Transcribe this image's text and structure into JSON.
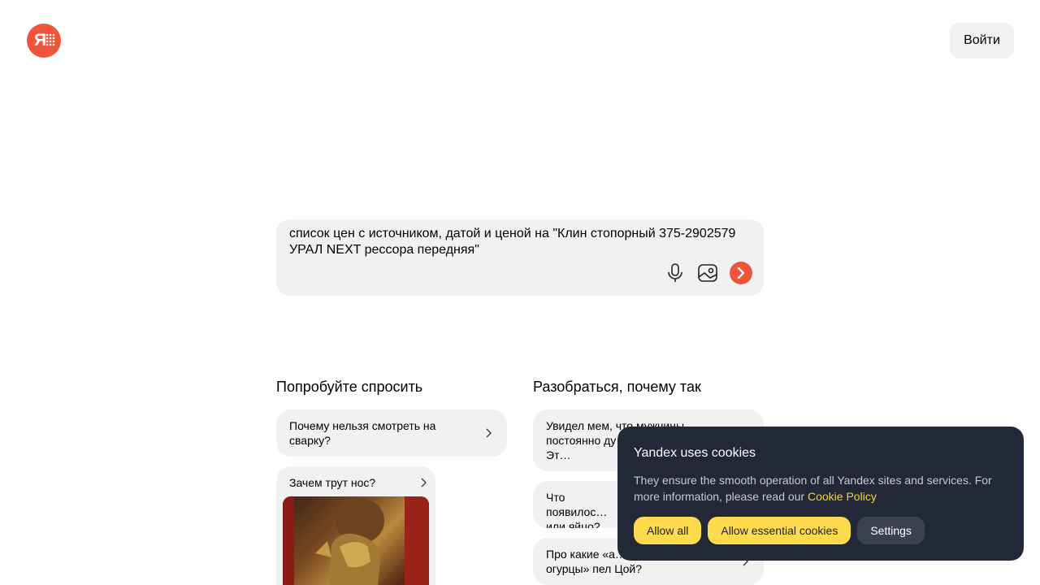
{
  "header": {
    "logo_text": "Я",
    "login_label": "Войти"
  },
  "search": {
    "value": "список цен с источником, датой и ценой на \"Клин стопорный 375-2902579 УРАЛ NEXT рессора передняя\""
  },
  "try_asking": {
    "title": "Попробуйте спросить",
    "items": [
      {
        "label": "Почему нельзя смотреть на сварку?"
      },
      {
        "label": "Зачем трут нос?"
      }
    ]
  },
  "understand_why": {
    "title": "Разобраться, почему так",
    "items": [
      {
        "label": "Увидел мем, что мужчины постоянно ду… империю. Эт…"
      },
      {
        "label": "Что появилос… или яйцо?"
      },
      {
        "label": "Про какие «а… огурцы» пел Цой?"
      }
    ]
  },
  "cookie_banner": {
    "title": "Yandex uses cookies",
    "text": "They ensure the smooth operation of all Yandex sites and services. For more information, please read our ",
    "link": "Cookie Policy",
    "allow_all": "Allow all",
    "allow_essential": "Allow essential cookies",
    "settings": "Settings"
  },
  "colors": {
    "brand": "#f0553c",
    "cookie_bg": "#232838",
    "cookie_link": "#ffcf2c",
    "button_yellow": "#ffdb4d"
  }
}
